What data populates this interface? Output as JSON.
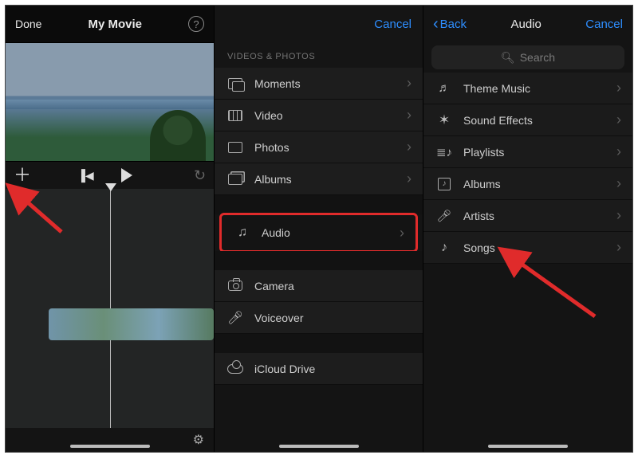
{
  "pane1": {
    "done": "Done",
    "title": "My Movie",
    "help": "?"
  },
  "pane2": {
    "cancel": "Cancel",
    "section_header": "VIDEOS & PHOTOS",
    "rows": {
      "moments": "Moments",
      "video": "Video",
      "photos": "Photos",
      "albums": "Albums",
      "audio": "Audio",
      "camera": "Camera",
      "voiceover": "Voiceover",
      "icloud": "iCloud Drive"
    }
  },
  "pane3": {
    "back": "Back",
    "title": "Audio",
    "cancel": "Cancel",
    "search_placeholder": "Search",
    "rows": {
      "theme": "Theme Music",
      "fx": "Sound Effects",
      "playlists": "Playlists",
      "albums": "Albums",
      "artists": "Artists",
      "songs": "Songs"
    }
  }
}
